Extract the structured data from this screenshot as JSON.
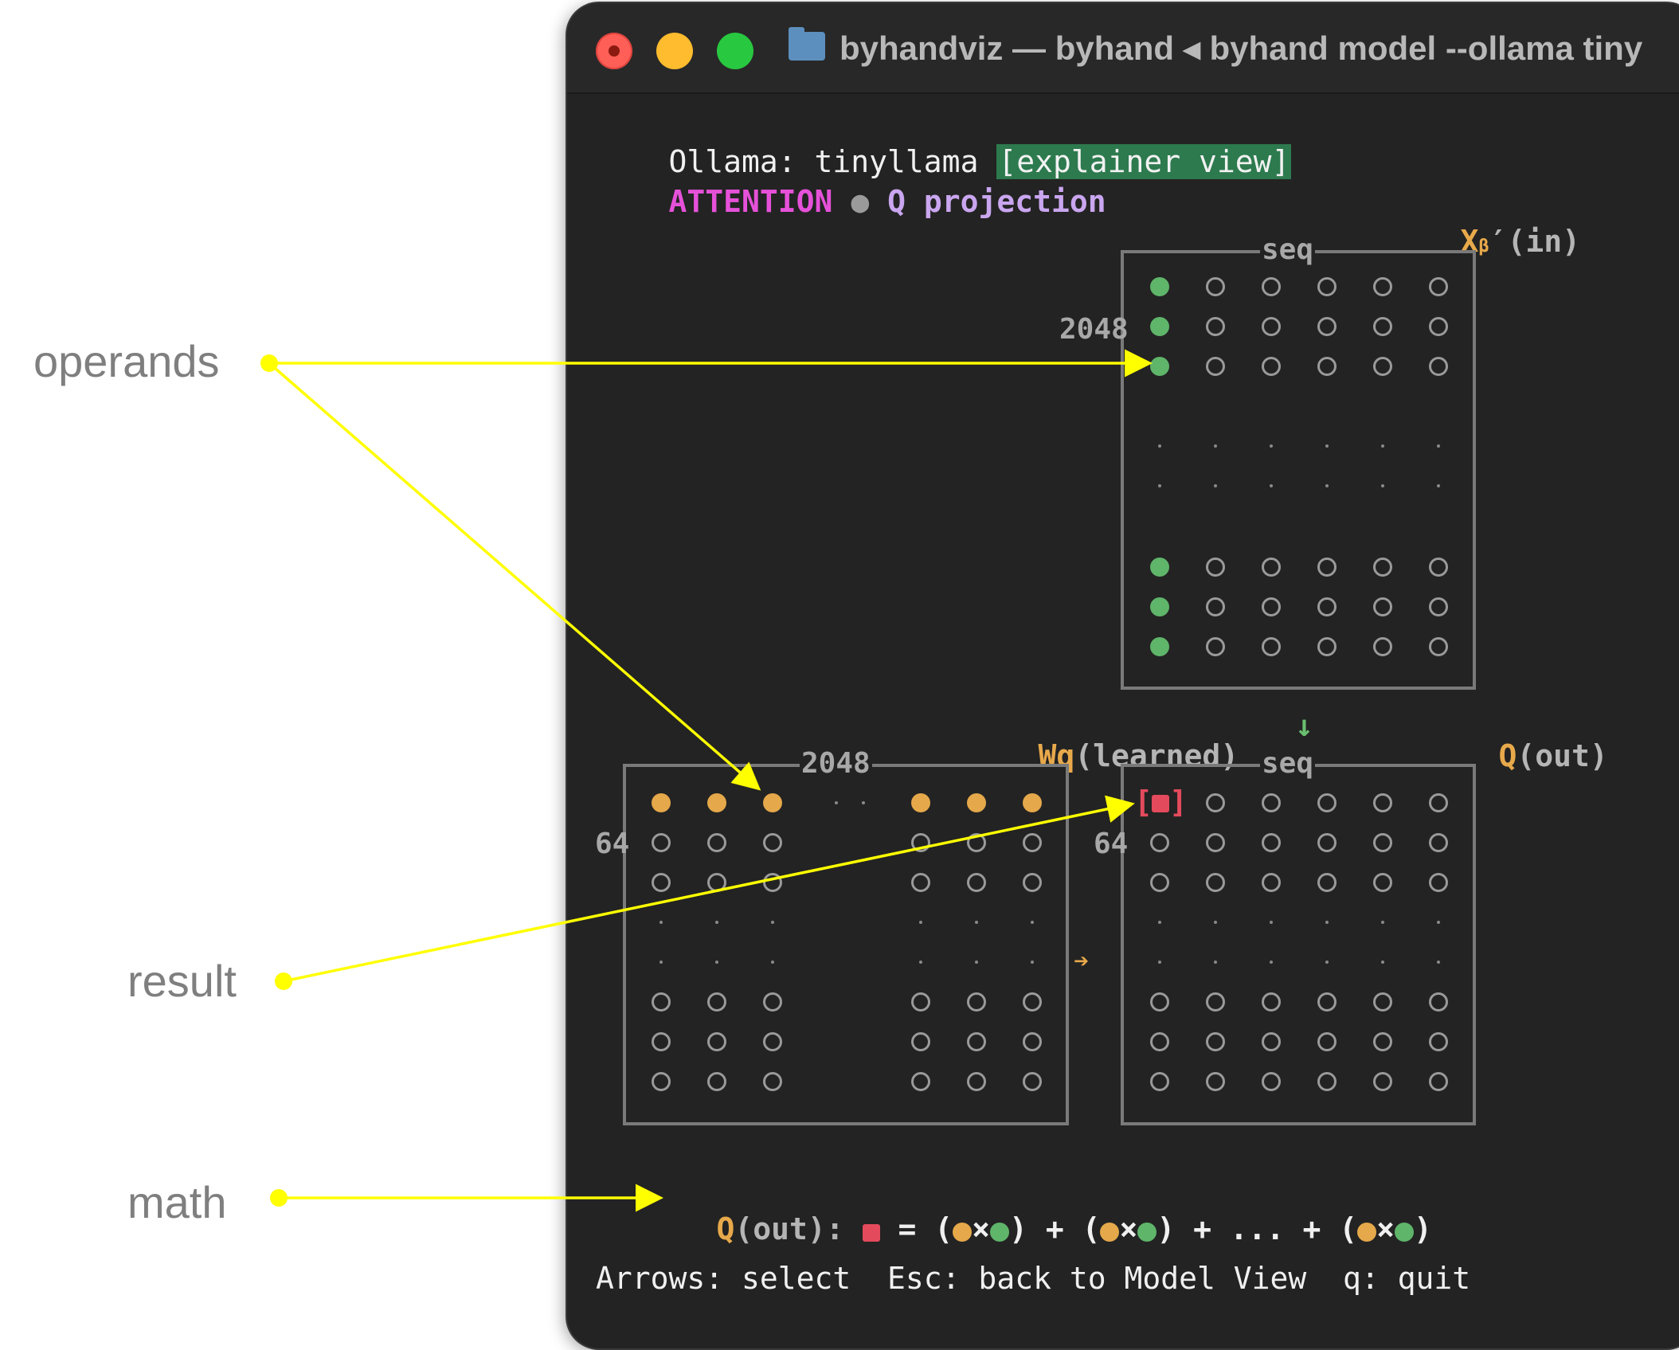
{
  "annotations": {
    "operands": "operands",
    "result": "result",
    "math": "math"
  },
  "window": {
    "title": "byhandviz — byhand ◂ byhand model --ollama tiny"
  },
  "header": {
    "line1_prefix": "Ollama: tinyllama",
    "view_tag": "[explainer view]",
    "section": "ATTENTION",
    "separator": "●",
    "step": "Q projection"
  },
  "x_matrix": {
    "title_main": "X",
    "title_sub": "β",
    "title_rest": "′(in)",
    "top_label": "seq",
    "side_label": "2048"
  },
  "wq_matrix": {
    "title_main": "Wq",
    "title_rest": "(learned)",
    "top_label": "2048",
    "side_label": "64"
  },
  "q_matrix": {
    "title_main": "Q",
    "title_rest": "(out)",
    "top_label": "seq",
    "side_label": "64",
    "down_arrow": "↓",
    "right_arrow": "➔",
    "selected_open": "[",
    "selected_close": "]"
  },
  "formula": {
    "lhs_main": "Q",
    "lhs_rest": "(out):",
    "equals": "=",
    "term_open": "(",
    "times": "×",
    "term_close": ")",
    "plus": "+",
    "ellipsis": "..."
  },
  "footer": {
    "text": "Arrows: select  Esc: back to Model View  q: quit"
  },
  "colors": {
    "annotation_arrow": "#ffff00",
    "operand_green": "#5fb56a",
    "operand_orange": "#e5a84a",
    "result_red": "#e34a5c",
    "attention_magenta": "#e651d9",
    "tag_background": "#2d7a4e"
  }
}
